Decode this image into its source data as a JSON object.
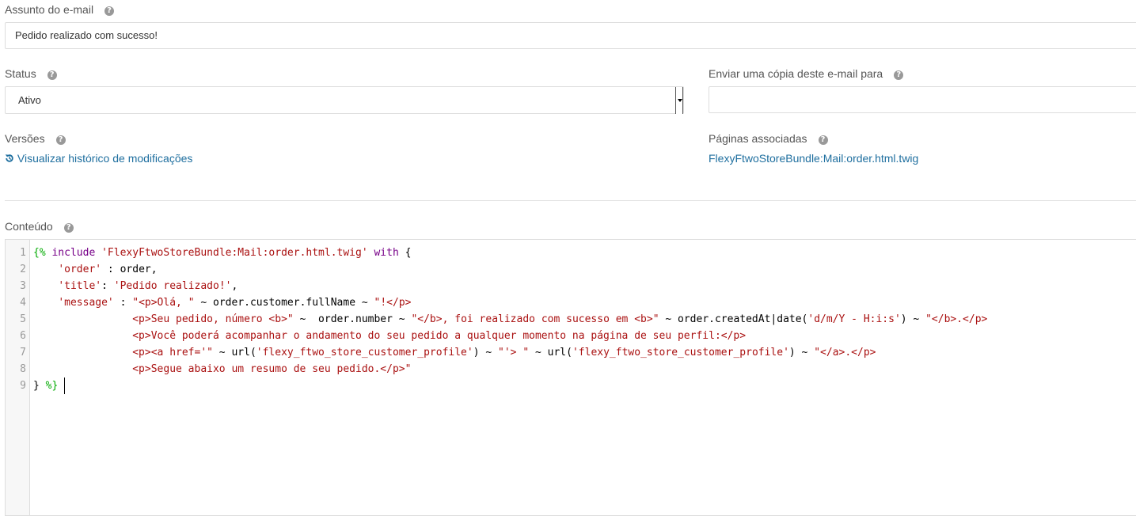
{
  "subject": {
    "label": "Assunto do e-mail",
    "value": "Pedido realizado com sucesso!"
  },
  "status": {
    "label": "Status",
    "selected": "Ativo"
  },
  "copy": {
    "label": "Enviar uma cópia deste e-mail para",
    "value": ""
  },
  "versions": {
    "label": "Versões",
    "link": "Visualizar histórico de modificações",
    "icon": "history-icon"
  },
  "pages": {
    "label": "Páginas associadas",
    "link": "FlexyFtwoStoreBundle:Mail:order.html.twig"
  },
  "content": {
    "label": "Conteúdo",
    "line_numbers": [
      "1",
      "2",
      "3",
      "4",
      "5",
      "6",
      "7",
      "8",
      "9"
    ],
    "lines": [
      [
        [
          "tw",
          "{%"
        ],
        [
          "",
          " "
        ],
        [
          "kw",
          "include"
        ],
        [
          "",
          " "
        ],
        [
          "st",
          "'FlexyFtwoStoreBundle:Mail:order.html.twig'"
        ],
        [
          "",
          " "
        ],
        [
          "kw",
          "with"
        ],
        [
          "",
          " {"
        ]
      ],
      [
        [
          "",
          "    "
        ],
        [
          "st",
          "'order'"
        ],
        [
          "",
          " : order,"
        ]
      ],
      [
        [
          "",
          "    "
        ],
        [
          "st",
          "'title'"
        ],
        [
          "",
          ": "
        ],
        [
          "st",
          "'Pedido realizado!'"
        ],
        [
          "",
          ","
        ]
      ],
      [
        [
          "",
          "    "
        ],
        [
          "st",
          "'message'"
        ],
        [
          "",
          " : "
        ],
        [
          "st",
          "\"<p>Olá, \""
        ],
        [
          "",
          " ~ order.customer.fullName ~ "
        ],
        [
          "st",
          "\"!</p>"
        ]
      ],
      [
        [
          "",
          "                "
        ],
        [
          "st",
          "<p>Seu pedido, número <b>\""
        ],
        [
          "",
          " ~  order.number ~ "
        ],
        [
          "st",
          "\"</b>, foi realizado com sucesso em <b>\""
        ],
        [
          "",
          " ~ order.createdAt|date("
        ],
        [
          "st",
          "'d/m/Y - H:i:s'"
        ],
        [
          "",
          ") ~ "
        ],
        [
          "st",
          "\"</b>.</p>"
        ]
      ],
      [
        [
          "",
          "                "
        ],
        [
          "st",
          "<p>Você poderá acompanhar o andamento do seu pedido a qualquer momento na página de seu perfil:</p>"
        ]
      ],
      [
        [
          "",
          "                "
        ],
        [
          "st",
          "<p><a href='\""
        ],
        [
          "",
          " ~ url("
        ],
        [
          "st",
          "'flexy_ftwo_store_customer_profile'"
        ],
        [
          "",
          ") ~ "
        ],
        [
          "st",
          "\"'> \""
        ],
        [
          "",
          " ~ url("
        ],
        [
          "st",
          "'flexy_ftwo_store_customer_profile'"
        ],
        [
          "",
          ") ~ "
        ],
        [
          "st",
          "\"</a>.</p>"
        ]
      ],
      [
        [
          "",
          "                "
        ],
        [
          "st",
          "<p>Segue abaixo um resumo de seu pedido.</p>\""
        ]
      ],
      [
        [
          "",
          "} "
        ],
        [
          "tw",
          "%}"
        ]
      ]
    ]
  }
}
